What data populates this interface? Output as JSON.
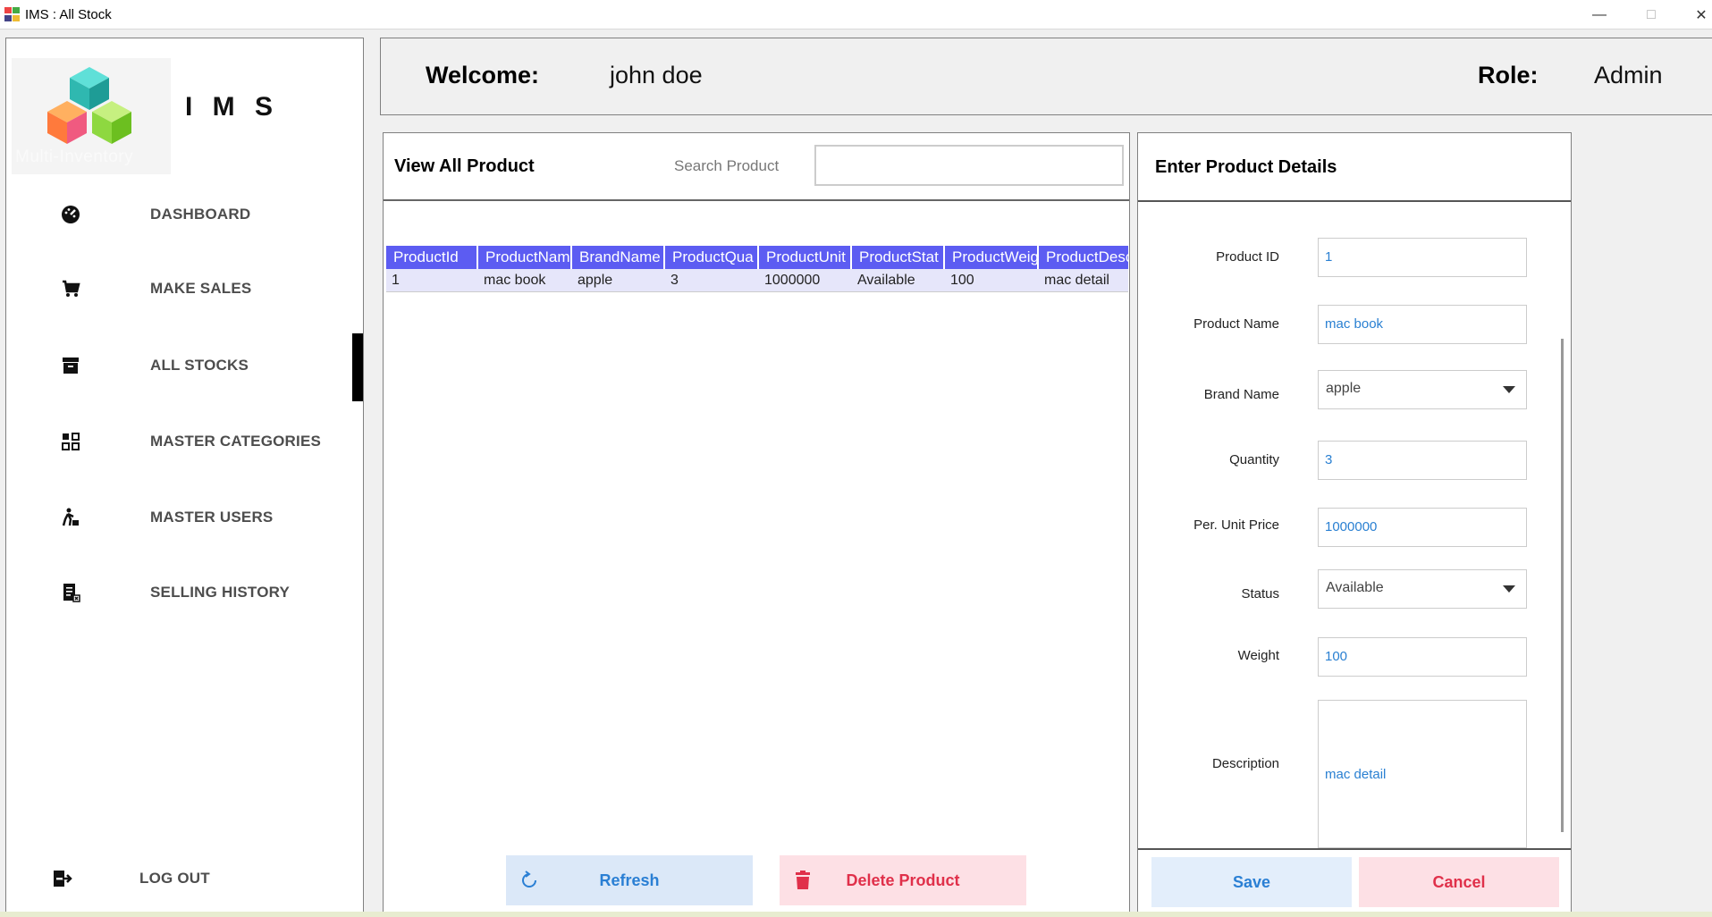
{
  "window": {
    "title": "IMS : All Stock",
    "min_glyph": "—",
    "max_glyph": "□",
    "close_glyph": "✕"
  },
  "sidebar": {
    "brand": "I M S",
    "logo_text": "Multi-Inventory",
    "items": [
      {
        "label": "DASHBOARD",
        "icon": "dashboard-icon"
      },
      {
        "label": "MAKE SALES",
        "icon": "cart-icon"
      },
      {
        "label": "ALL STOCKS",
        "icon": "archive-icon",
        "active": true
      },
      {
        "label": "MASTER CATEGORIES",
        "icon": "categories-icon"
      },
      {
        "label": "MASTER USERS",
        "icon": "users-icon"
      },
      {
        "label": "SELLING HISTORY",
        "icon": "history-icon"
      }
    ],
    "logout_label": "LOG OUT"
  },
  "header": {
    "welcome_label": "Welcome:",
    "user_name": "john doe",
    "role_label": "Role:",
    "role_value": "Admin"
  },
  "products_panel": {
    "title": "View All Product",
    "search_label": "Search Product",
    "search_value": "",
    "columns": [
      "ProductId",
      "ProductNam",
      "BrandName",
      "ProductQua",
      "ProductUnit",
      "ProductStat",
      "ProductWeig",
      "ProductDesc"
    ],
    "rows": [
      [
        "1",
        "mac book",
        "apple",
        "3",
        "1000000",
        "Available",
        "100",
        "mac detail"
      ]
    ],
    "refresh_label": "Refresh",
    "delete_label": "Delete Product"
  },
  "details_panel": {
    "title": "Enter Product Details",
    "fields": {
      "product_id": {
        "label": "Product ID",
        "value": "1"
      },
      "product_name": {
        "label": "Product Name",
        "value": "mac book"
      },
      "brand_name": {
        "label": "Brand Name",
        "value": "apple"
      },
      "quantity": {
        "label": "Quantity",
        "value": "3"
      },
      "unit_price": {
        "label": "Per. Unit Price",
        "value": "1000000"
      },
      "status": {
        "label": "Status",
        "value": "Available"
      },
      "weight": {
        "label": "Weight",
        "value": "100"
      },
      "description": {
        "label": "Description",
        "value": "mac detail"
      }
    },
    "save_label": "Save",
    "cancel_label": "Cancel"
  },
  "colors": {
    "grid_header": "#5c5cf2",
    "accent_blue": "#2a7fd4",
    "danger_red": "#e0304a"
  }
}
